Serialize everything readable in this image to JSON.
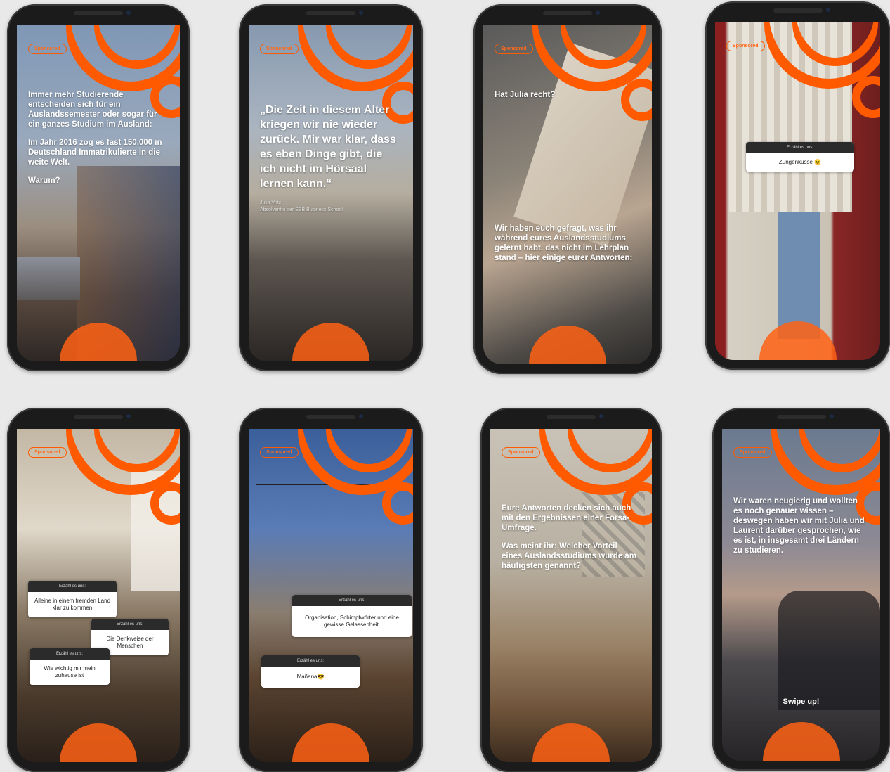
{
  "brand": {
    "accent": "#ff5a00"
  },
  "sponsored_label": "Sponsored",
  "question_header": "Erzähl es uns:",
  "stories": [
    {
      "paragraphs": [
        "Immer mehr Studierende entscheiden sich für ein Auslandssemester oder sogar für ein ganzes Studium im Ausland:",
        "Im Jahr 2016 zog es fast 150.000 in Deutschland Immatrikulierte in die weite Welt.",
        "Warum?"
      ]
    },
    {
      "quote": "„Die Zeit in diesem Alter kriegen wir nie wieder zurück. Mir war klar, dass es eben Dinge gibt, die ich nicht im Hörsaal lernen kann.“",
      "credit_name": "Julia Vritz",
      "credit_role": "Absolventin der ESB Business School"
    },
    {
      "heading": "Hat Julia recht?",
      "body": "Wir haben euch gefragt, was ihr während eures Auslandsstudiums gelernt habt, das nicht im Lehrplan stand – hier einige eurer Antworten:"
    },
    {
      "answers": [
        "Zungenküsse 😉"
      ]
    },
    {
      "answers": [
        "Alleine in einem fremden Land klar zu kommen",
        "Die Denkweise der Menschen",
        "Wie wichtig mir mein zuhause ist"
      ]
    },
    {
      "answers": [
        "Organisation, Schimpfwörter und eine gewisse Gelassenheit.",
        "Mañana😎"
      ]
    },
    {
      "paragraphs": [
        "Eure Antworten decken sich auch mit den Ergebnissen einer Forsa-Umfrage.",
        "Was meint ihr: Welcher Vorteil eines Auslandsstudiums wurde am häufigsten genannt?"
      ]
    },
    {
      "paragraphs": [
        "Wir waren neugierig und wollten es noch genauer wissen – deswegen haben wir mit Julia und Laurent darüber gesprochen, wie es ist, in insgesamt drei Ländern zu studieren."
      ],
      "cta": "Swipe up!"
    }
  ]
}
